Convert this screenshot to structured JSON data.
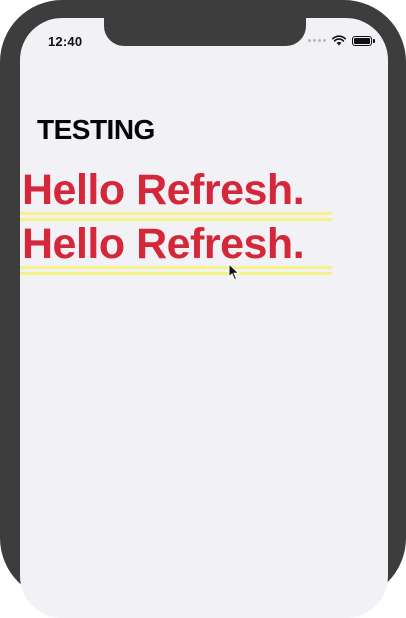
{
  "status_bar": {
    "time": "12:40",
    "icons": [
      "cellular-dots-icon",
      "wifi-icon",
      "battery-icon"
    ]
  },
  "content": {
    "title": "TESTING",
    "lines": [
      "Hello Refresh.",
      "Hello Refresh."
    ]
  },
  "colors": {
    "background": "#f1f1f6",
    "device_frame": "#3d3d3d",
    "title": "#050505",
    "hello_text": "#d4283a",
    "underline": "#f5f387"
  }
}
